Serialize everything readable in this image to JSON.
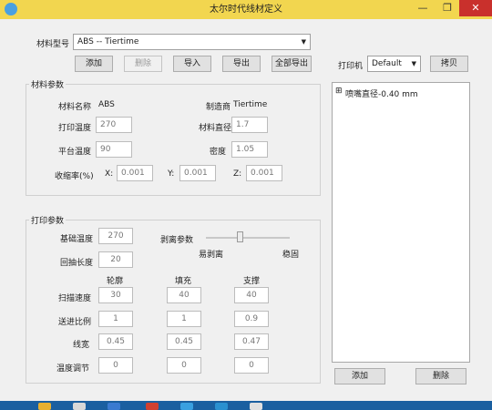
{
  "window": {
    "title": "太尔时代线材定义",
    "min": "—",
    "max": "❐",
    "close": "✕"
  },
  "material_type": {
    "label": "材料型号",
    "value": "ABS -- Tiertime"
  },
  "buttons": {
    "add": "添加",
    "delete": "删除",
    "import": "导入",
    "export": "导出",
    "export_all": "全部导出"
  },
  "printer": {
    "label": "打印机",
    "value": "Default",
    "copy": "拷贝"
  },
  "material_params": {
    "title": "材料参数",
    "name_label": "材料名称",
    "name_value": "ABS",
    "maker_label": "制造商",
    "maker_value": "Tiertime",
    "print_temp_label": "打印温度",
    "print_temp": "270",
    "diameter_label": "材料直径",
    "diameter": "1.7",
    "bed_temp_label": "平台温度",
    "bed_temp": "90",
    "density_label": "密度",
    "density": "1.05",
    "shrink_label": "收缩率(%)",
    "x_label": "X:",
    "x": "0.001",
    "y_label": "Y:",
    "y": "0.001",
    "z_label": "Z:",
    "z": "0.001"
  },
  "print_params": {
    "title": "打印参数",
    "base_temp_label": "基础温度",
    "base_temp": "270",
    "retract_label": "回抽长度",
    "retract": "20",
    "separation_label": "剥离参数",
    "easy_label": "易剥离",
    "stable_label": "稳固",
    "separation_level": 0.4,
    "col_outline": "轮廓",
    "col_fill": "填充",
    "col_support": "支撑",
    "rows": [
      {
        "label": "扫描速度",
        "outline": "30",
        "fill": "40",
        "support": "40"
      },
      {
        "label": "送进比例",
        "outline": "1",
        "fill": "1",
        "support": "0.9"
      },
      {
        "label": "线宽",
        "outline": "0.45",
        "fill": "0.45",
        "support": "0.47"
      },
      {
        "label": "温度调节",
        "outline": "0",
        "fill": "0",
        "support": "0"
      }
    ]
  },
  "tree": {
    "expander": "⊞",
    "item": "喷嘴直径-0.40 mm"
  },
  "bottom_buttons": {
    "add": "添加",
    "delete": "删除"
  }
}
